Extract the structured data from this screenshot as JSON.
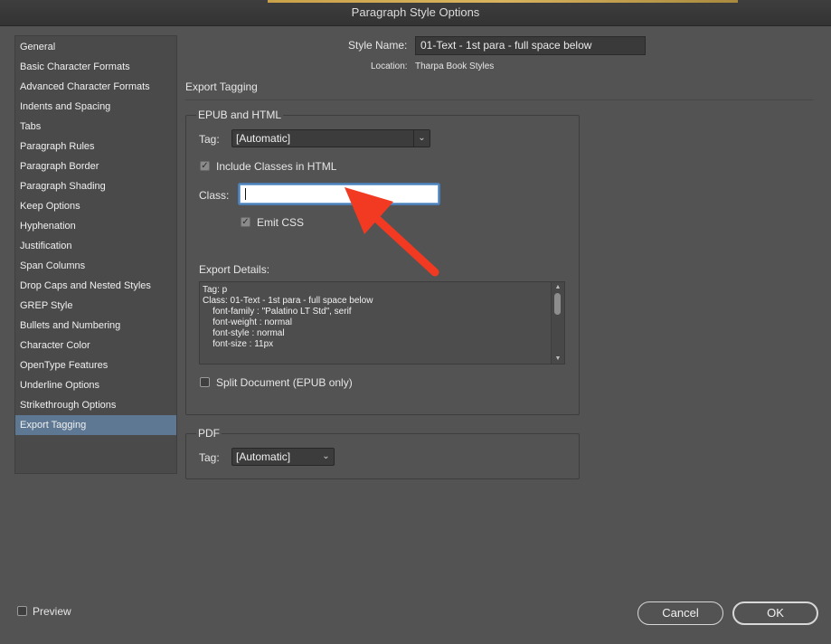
{
  "window": {
    "title": "Paragraph Style Options"
  },
  "sidebar": {
    "items": [
      "General",
      "Basic Character Formats",
      "Advanced Character Formats",
      "Indents and Spacing",
      "Tabs",
      "Paragraph Rules",
      "Paragraph Border",
      "Paragraph Shading",
      "Keep Options",
      "Hyphenation",
      "Justification",
      "Span Columns",
      "Drop Caps and Nested Styles",
      "GREP Style",
      "Bullets and Numbering",
      "Character Color",
      "OpenType Features",
      "Underline Options",
      "Strikethrough Options",
      "Export Tagging"
    ],
    "selected": "Export Tagging"
  },
  "header": {
    "style_name_label": "Style Name:",
    "style_name_value": "01-Text - 1st para - full space below",
    "location_label": "Location:",
    "location_value": "Tharpa Book Styles",
    "section_title": "Export Tagging"
  },
  "epub": {
    "group_title": "EPUB and HTML",
    "tag_label": "Tag:",
    "tag_value": "[Automatic]",
    "include_classes_label": "Include Classes in HTML",
    "include_classes_checked": true,
    "class_label": "Class:",
    "class_value": "",
    "emit_css_label": "Emit CSS",
    "emit_css_checked": true,
    "export_details_label": "Export Details:",
    "export_details_lines": [
      "Tag: p",
      "Class: 01-Text - 1st para - full space below",
      "    font-family : \"Palatino LT Std\", serif",
      "    font-weight : normal",
      "    font-style : normal",
      "    font-size : 11px"
    ],
    "split_document_label": "Split Document (EPUB only)",
    "split_document_checked": false
  },
  "pdf": {
    "group_title": "PDF",
    "tag_label": "Tag:",
    "tag_value": "[Automatic]"
  },
  "footer": {
    "preview_label": "Preview",
    "preview_checked": false,
    "cancel_label": "Cancel",
    "ok_label": "OK"
  },
  "colors": {
    "dialog_bg": "#535353",
    "selection": "#5e7893",
    "annotation_arrow": "#f23a22"
  },
  "icons": {
    "dropdown": "chevron-down-icon",
    "checkbox": "checkmark-icon",
    "annotation": "red-arrow-icon"
  }
}
